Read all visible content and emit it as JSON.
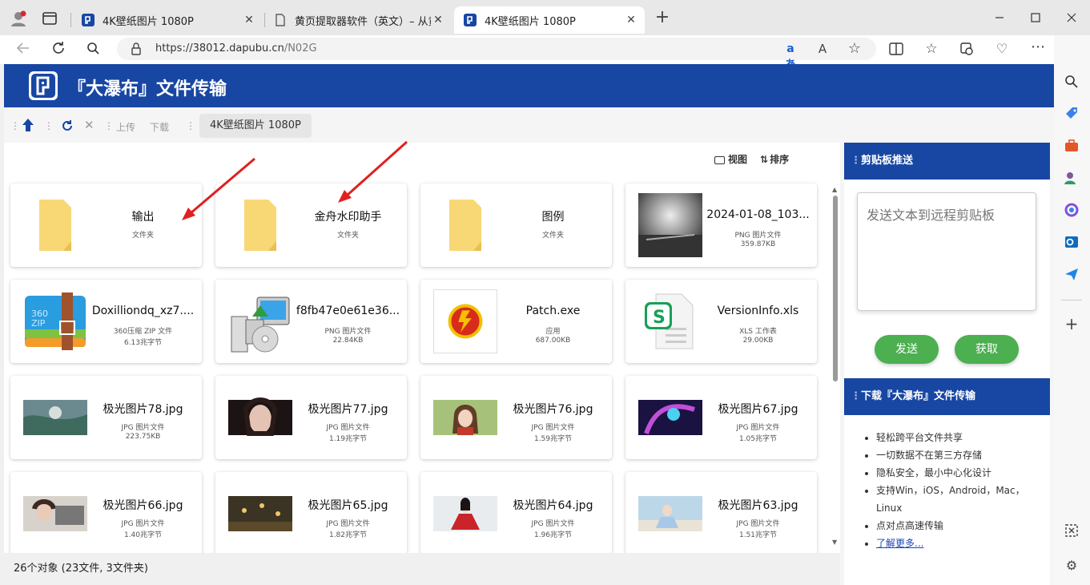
{
  "browser": {
    "tabs": [
      {
        "title": "4K壁纸图片 1080P",
        "active": false
      },
      {
        "title": "黄页提取器软件（英文）– 从黄页",
        "active": false
      },
      {
        "title": "4K壁纸图片 1080P",
        "active": true
      }
    ],
    "new_tab": "+",
    "url_base": "https://38012.dapubu.cn",
    "url_path": "/N02G",
    "window_controls": [
      "minimize",
      "maximize",
      "close"
    ]
  },
  "header": {
    "site_title": "『大瀑布』文件传输"
  },
  "toolbar": {
    "upload_label": "上传",
    "download_label": "下载",
    "breadcrumb": "4K壁纸图片 1080P",
    "view_label": "视图",
    "sort_label": "排序"
  },
  "files": [
    {
      "name": "输出",
      "type": "文件夹",
      "size": "",
      "thumb": "folder"
    },
    {
      "name": "金舟水印助手",
      "type": "文件夹",
      "size": "",
      "thumb": "folder"
    },
    {
      "name": "图例",
      "type": "文件夹",
      "size": "",
      "thumb": "folder"
    },
    {
      "name": "2024-01-08_103...",
      "type": "PNG 图片文件",
      "size": "359.87KB",
      "thumb": "bw-photo"
    },
    {
      "name": "Doxilliondq_xz7....",
      "type": "360压缩 ZIP 文件",
      "size": "6.13兆字节",
      "thumb": "zip"
    },
    {
      "name": "f8fb47e0e61e36...",
      "type": "PNG 图片文件",
      "size": "22.84KB",
      "thumb": "installer"
    },
    {
      "name": "Patch.exe",
      "type": "应用",
      "size": "687.00KB",
      "thumb": "patch"
    },
    {
      "name": "VersionInfo.xls",
      "type": "XLS 工作表",
      "size": "29.00KB",
      "thumb": "xls"
    },
    {
      "name": "极光图片78.jpg",
      "type": "JPG 图片文件",
      "size": "223.75KB",
      "thumb": "img78"
    },
    {
      "name": "极光图片77.jpg",
      "type": "JPG 图片文件",
      "size": "1.19兆字节",
      "thumb": "img77"
    },
    {
      "name": "极光图片76.jpg",
      "type": "JPG 图片文件",
      "size": "1.59兆字节",
      "thumb": "img76"
    },
    {
      "name": "极光图片67.jpg",
      "type": "JPG 图片文件",
      "size": "1.05兆字节",
      "thumb": "img67"
    },
    {
      "name": "极光图片66.jpg",
      "type": "JPG 图片文件",
      "size": "1.40兆字节",
      "thumb": "img66"
    },
    {
      "name": "极光图片65.jpg",
      "type": "JPG 图片文件",
      "size": "1.82兆字节",
      "thumb": "img65"
    },
    {
      "name": "极光图片64.jpg",
      "type": "JPG 图片文件",
      "size": "1.96兆字节",
      "thumb": "img64"
    },
    {
      "name": "极光图片63.jpg",
      "type": "JPG 图片文件",
      "size": "1.51兆字节",
      "thumb": "img63"
    }
  ],
  "status": {
    "summary": "26个对象 (23文件, 3文件夹)"
  },
  "clipboard": {
    "title": "剪贴板推送",
    "placeholder": "发送文本到远程剪贴板",
    "send_label": "发送",
    "fetch_label": "获取"
  },
  "download_panel": {
    "title": "下载『大瀑布』文件传输",
    "features": [
      "轻松跨平台文件共享",
      "一切数据不在第三方存储",
      "隐私安全，最小中心化设计",
      "支持Win，iOS，Android，Mac，Linux",
      "点对点高速传输"
    ],
    "more_link": "了解更多..."
  },
  "colors": {
    "brand_blue": "#1846a3",
    "button_green": "#4caf50",
    "arrow_red": "#e02020",
    "folder_yellow": "#f8d775"
  }
}
